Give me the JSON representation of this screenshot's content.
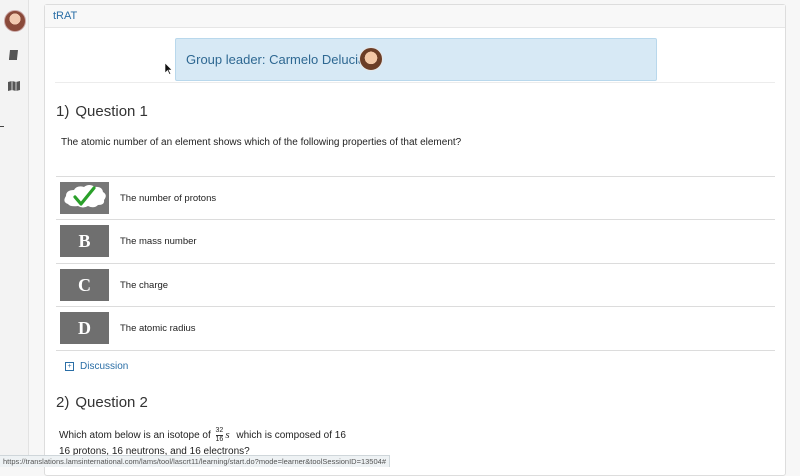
{
  "panel": {
    "title": "tRAT"
  },
  "leader": {
    "label": "Group leader: Carmelo Delucia"
  },
  "questions": [
    {
      "number": "1)",
      "title": "Question 1",
      "text": "The atomic number of an element shows which of the following properties of that element?",
      "options": [
        {
          "letter": "A",
          "label": "The number of protons",
          "state": "correct"
        },
        {
          "letter": "B",
          "label": "The mass number"
        },
        {
          "letter": "C",
          "label": "The charge"
        },
        {
          "letter": "D",
          "label": "The atomic radius"
        }
      ],
      "discussion_label": "Discussion"
    },
    {
      "number": "2)",
      "title": "Question 2",
      "text_prefix": "Which atom below is an isotope of",
      "isotope": {
        "mass": "32",
        "atomic": "16",
        "symbol": "s"
      },
      "text_suffix": "which is composed of 16",
      "text_line2": "16 protons, 16 neutrons, and 16 electrons?"
    }
  ],
  "status_url": "https://translations.lamsinternational.com/lams/tool/lascrt11/learning/start.do?mode=learner&toolSessionID=13504#",
  "colors": {
    "accent": "#2a6ea6",
    "leader_bg": "#d7e9f5",
    "option_box": "#6f6f6f",
    "correct_check": "#2aa02a"
  }
}
